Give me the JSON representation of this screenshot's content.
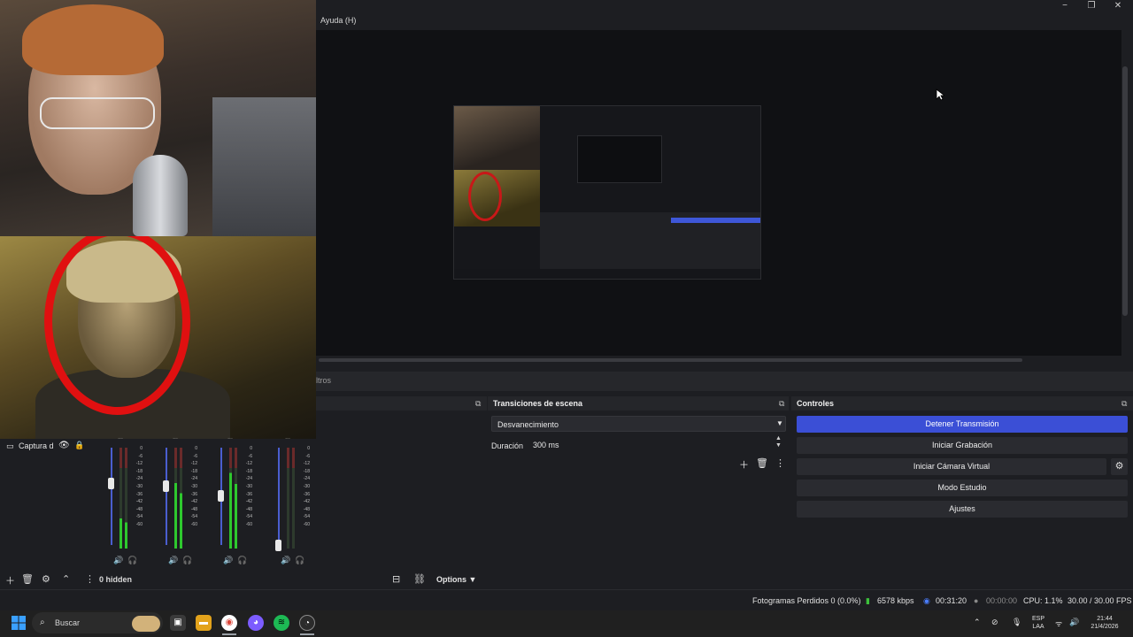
{
  "window": {
    "menu_help": "Ayuda (H)",
    "minimize_icon": "−",
    "restore_icon": "❐",
    "close_icon": "✕"
  },
  "filters_tab": {
    "label": "ltros"
  },
  "sources": {
    "item_label": "Captura d",
    "hidden_count": "0 hidden",
    "options_label": "Options"
  },
  "mixer": {
    "ticks": [
      "0",
      "-6",
      "-12",
      "-18",
      "-24",
      "-30",
      "-36",
      "-42",
      "-48",
      "-54",
      "-60"
    ],
    "channel_titles": [
      "...",
      "...",
      "...",
      "..."
    ],
    "volume_icon": "🔊",
    "headphone_icon": "🎧"
  },
  "transitions": {
    "title": "Transiciones de escena",
    "selected": "Desvanecimiento",
    "duration_label": "Duración",
    "duration_value": "300 ms"
  },
  "controls": {
    "title": "Controles",
    "buttons": [
      "Detener Transmisión",
      "Iniciar Grabación",
      "Iniciar Cámara Virtual",
      "Modo Estudio",
      "Ajustes"
    ],
    "active_color": "#3b4fd6"
  },
  "status": {
    "dropped_frames": "Fotogramas Perdidos 0 (0.0%)",
    "bitrate": "6578 kbps",
    "stream_time": "00:31:20",
    "record_time": "00:00:00",
    "cpu": "CPU: 1.1%",
    "fps": "30.00 / 30.00 FPS"
  },
  "taskbar": {
    "search_placeholder": "Buscar",
    "lang_top": "ESP",
    "lang_bottom": "LAA",
    "time": "21:44",
    "date": "21/4/2026"
  }
}
